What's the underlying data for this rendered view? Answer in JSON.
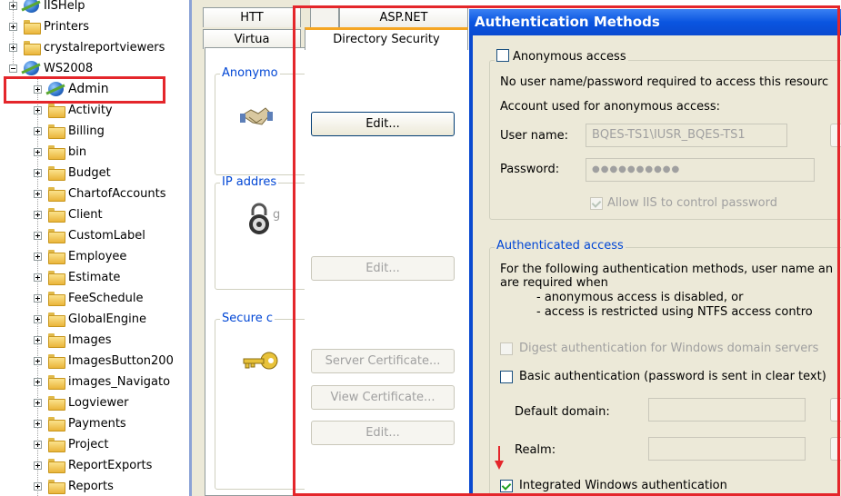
{
  "tree": {
    "items": [
      {
        "label": "IISHelp",
        "icon": "globe-icon",
        "depth": 1,
        "expand": "plus"
      },
      {
        "label": "Printers",
        "icon": "folder-icon",
        "depth": 1,
        "expand": "plus"
      },
      {
        "label": "crystalreportviewers",
        "icon": "folder-icon",
        "depth": 1,
        "expand": "plus"
      },
      {
        "label": "WS2008",
        "icon": "globe-icon",
        "depth": 1,
        "expand": "minus"
      },
      {
        "label": "Admin",
        "icon": "globe-icon",
        "depth": 2,
        "expand": "plus",
        "highlighted": true
      },
      {
        "label": "Activity",
        "icon": "folder-icon",
        "depth": 2,
        "expand": "plus"
      },
      {
        "label": "Billing",
        "icon": "folder-icon",
        "depth": 2,
        "expand": "plus"
      },
      {
        "label": "bin",
        "icon": "folder-icon",
        "depth": 2,
        "expand": "plus"
      },
      {
        "label": "Budget",
        "icon": "folder-icon",
        "depth": 2,
        "expand": "plus"
      },
      {
        "label": "ChartofAccounts",
        "icon": "folder-icon",
        "depth": 2,
        "expand": "plus"
      },
      {
        "label": "Client",
        "icon": "folder-icon",
        "depth": 2,
        "expand": "plus"
      },
      {
        "label": "CustomLabel",
        "icon": "folder-icon",
        "depth": 2,
        "expand": "plus"
      },
      {
        "label": "Employee",
        "icon": "folder-icon",
        "depth": 2,
        "expand": "plus"
      },
      {
        "label": "Estimate",
        "icon": "folder-icon",
        "depth": 2,
        "expand": "plus"
      },
      {
        "label": "FeeSchedule",
        "icon": "folder-icon",
        "depth": 2,
        "expand": "plus"
      },
      {
        "label": "GlobalEngine",
        "icon": "folder-icon",
        "depth": 2,
        "expand": "plus"
      },
      {
        "label": "Images",
        "icon": "folder-icon",
        "depth": 2,
        "expand": "plus"
      },
      {
        "label": "ImagesButton200",
        "icon": "folder-icon",
        "depth": 2,
        "expand": "plus"
      },
      {
        "label": "images_Navigato",
        "icon": "folder-icon",
        "depth": 2,
        "expand": "plus"
      },
      {
        "label": "Logviewer",
        "icon": "folder-icon",
        "depth": 2,
        "expand": "plus"
      },
      {
        "label": "Payments",
        "icon": "folder-icon",
        "depth": 2,
        "expand": "plus"
      },
      {
        "label": "Project",
        "icon": "folder-icon",
        "depth": 2,
        "expand": "plus"
      },
      {
        "label": "ReportExports",
        "icon": "folder-icon",
        "depth": 2,
        "expand": "plus"
      },
      {
        "label": "Reports",
        "icon": "folder-icon",
        "depth": 2,
        "expand": "plus"
      }
    ]
  },
  "properties": {
    "tabs_row1": [
      "HTT",
      "",
      "ASP.NET"
    ],
    "tabs_row2": [
      "Virtua",
      "Directory Security"
    ],
    "groups": {
      "anonymous": {
        "legend": "Anonymo",
        "edit": "Edit..."
      },
      "ip": {
        "legend": "IP addres",
        "edit": "Edit..."
      },
      "secure": {
        "legend": "Secure c",
        "server_cert": "Server Certificate...",
        "view_cert": "View Certificate...",
        "edit": "Edit..."
      }
    },
    "ip_trailing": "g"
  },
  "auth": {
    "title": "Authentication Methods",
    "anonymous": {
      "label": "Anonymous access",
      "checked": false,
      "desc": "No user name/password required to access this resourc",
      "account_label": "Account used for anonymous access:",
      "username_label": "User name:",
      "username_value": "BQES-TS1\\IUSR_BQES-TS1",
      "password_label": "Password:",
      "password_value": "●●●●●●●●●●",
      "allow_iis": "Allow IIS to control password",
      "allow_iis_checked": true
    },
    "authenticated": {
      "legend": "Authenticated access",
      "desc1": "For the following authentication methods, user name an",
      "desc2": "are required when",
      "bullet1": "- anonymous access is disabled, or",
      "bullet2": "- access is restricted using NTFS access contro",
      "digest": "Digest authentication for Windows domain servers",
      "digest_checked": false,
      "basic": "Basic authentication (password is sent in clear text)",
      "basic_checked": false,
      "default_domain_label": "Default domain:",
      "default_domain_value": "",
      "realm_label": "Realm:",
      "realm_value": "",
      "integrated": "Integrated Windows authentication",
      "integrated_checked": true
    }
  },
  "colors": {
    "highlight": "#e4262b",
    "title_bar": "#0a55e0",
    "legend_text": "#0046d5"
  }
}
